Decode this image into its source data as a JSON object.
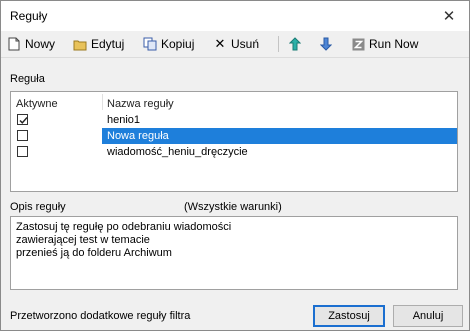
{
  "window": {
    "title": "Reguły"
  },
  "toolbar": {
    "new_label": "Nowy",
    "edit_label": "Edytuj",
    "copy_label": "Kopiuj",
    "delete_label": "Usuń",
    "run_now_label": "Run Now"
  },
  "rules": {
    "section_label": "Reguła",
    "col_active": "Aktywne",
    "col_name": "Nazwa reguły",
    "items": [
      {
        "name": "henio1",
        "active": true,
        "selected": false
      },
      {
        "name": "Nowa reguła",
        "active": false,
        "selected": true
      },
      {
        "name": "wiadomość_heniu_dręczycie",
        "active": false,
        "selected": false
      }
    ]
  },
  "description": {
    "label": "Opis reguły",
    "conditions": "(Wszystkie warunki)",
    "lines": [
      "Zastosuj tę regułę po odebraniu wiadomości",
      "zawierającej test w temacie",
      "przenieś ją do folderu Archiwum"
    ]
  },
  "footer": {
    "status": "Przetworzono dodatkowe reguły filtra",
    "apply_label": "Zastosuj",
    "cancel_label": "Anuluj"
  }
}
